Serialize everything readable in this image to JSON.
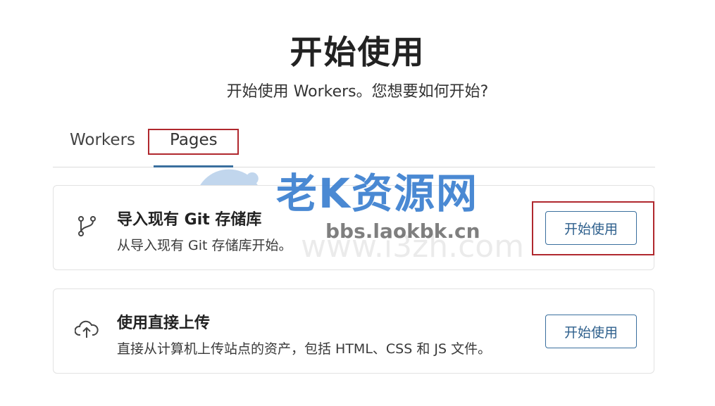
{
  "page": {
    "title": "开始使用",
    "subtitle": "开始使用 Workers。您想要如何开始?"
  },
  "tabs": [
    {
      "label": "Workers",
      "active": false
    },
    {
      "label": "Pages",
      "active": true
    }
  ],
  "cards": [
    {
      "icon": "git-branch-icon",
      "title": "导入现有 Git 存储库",
      "description": "从导入现有 Git 存储库开始。",
      "button_label": "开始使用"
    },
    {
      "icon": "cloud-upload-icon",
      "title": "使用直接上传",
      "description": "直接从计算机上传站点的资产，包括 HTML、CSS 和 JS 文件。",
      "button_label": "开始使用"
    }
  ],
  "watermark": {
    "brand": "老K资源网",
    "url": "bbs.laokbk.cn",
    "faint_url": "www.i3zh.com"
  },
  "colors": {
    "accent": "#3a6f9e",
    "highlight": "#b0282e",
    "border": "#e2e2e2"
  }
}
